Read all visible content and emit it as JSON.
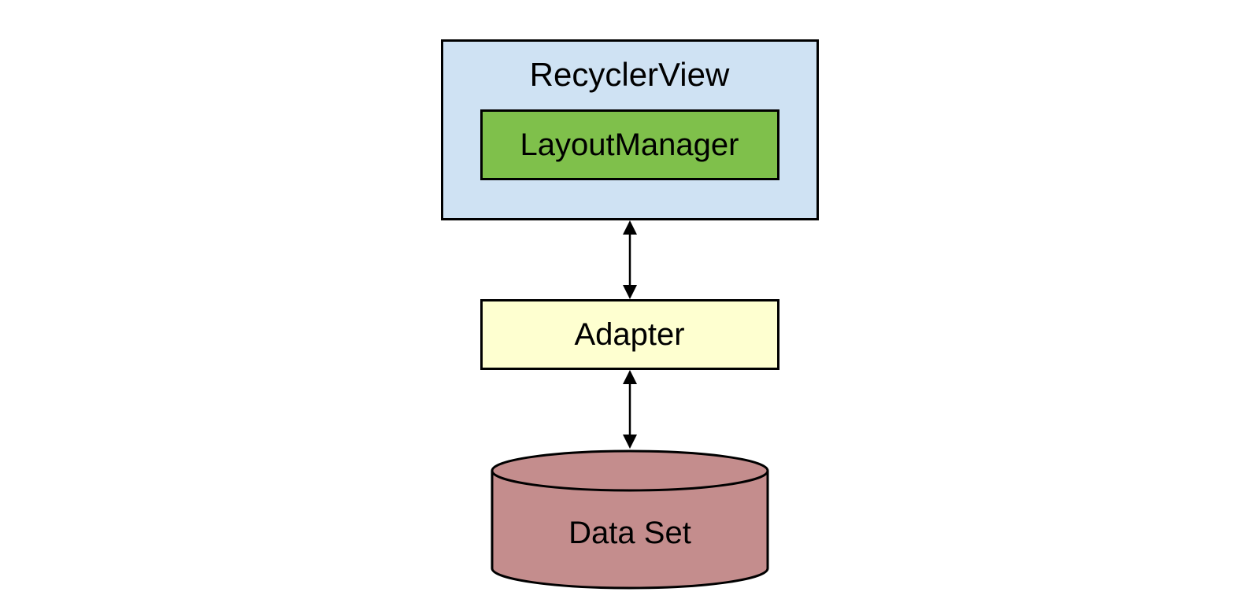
{
  "diagram": {
    "recyclerview": {
      "title": "RecyclerView",
      "child": {
        "title": "LayoutManager"
      }
    },
    "adapter": {
      "title": "Adapter"
    },
    "dataset": {
      "title": "Data Set"
    },
    "colors": {
      "recyclerview_bg": "#cfe2f3",
      "layoutmanager_bg": "#7fc04b",
      "adapter_bg": "#feffd0",
      "dataset_bg": "#c48d8d",
      "border": "#000000"
    }
  }
}
